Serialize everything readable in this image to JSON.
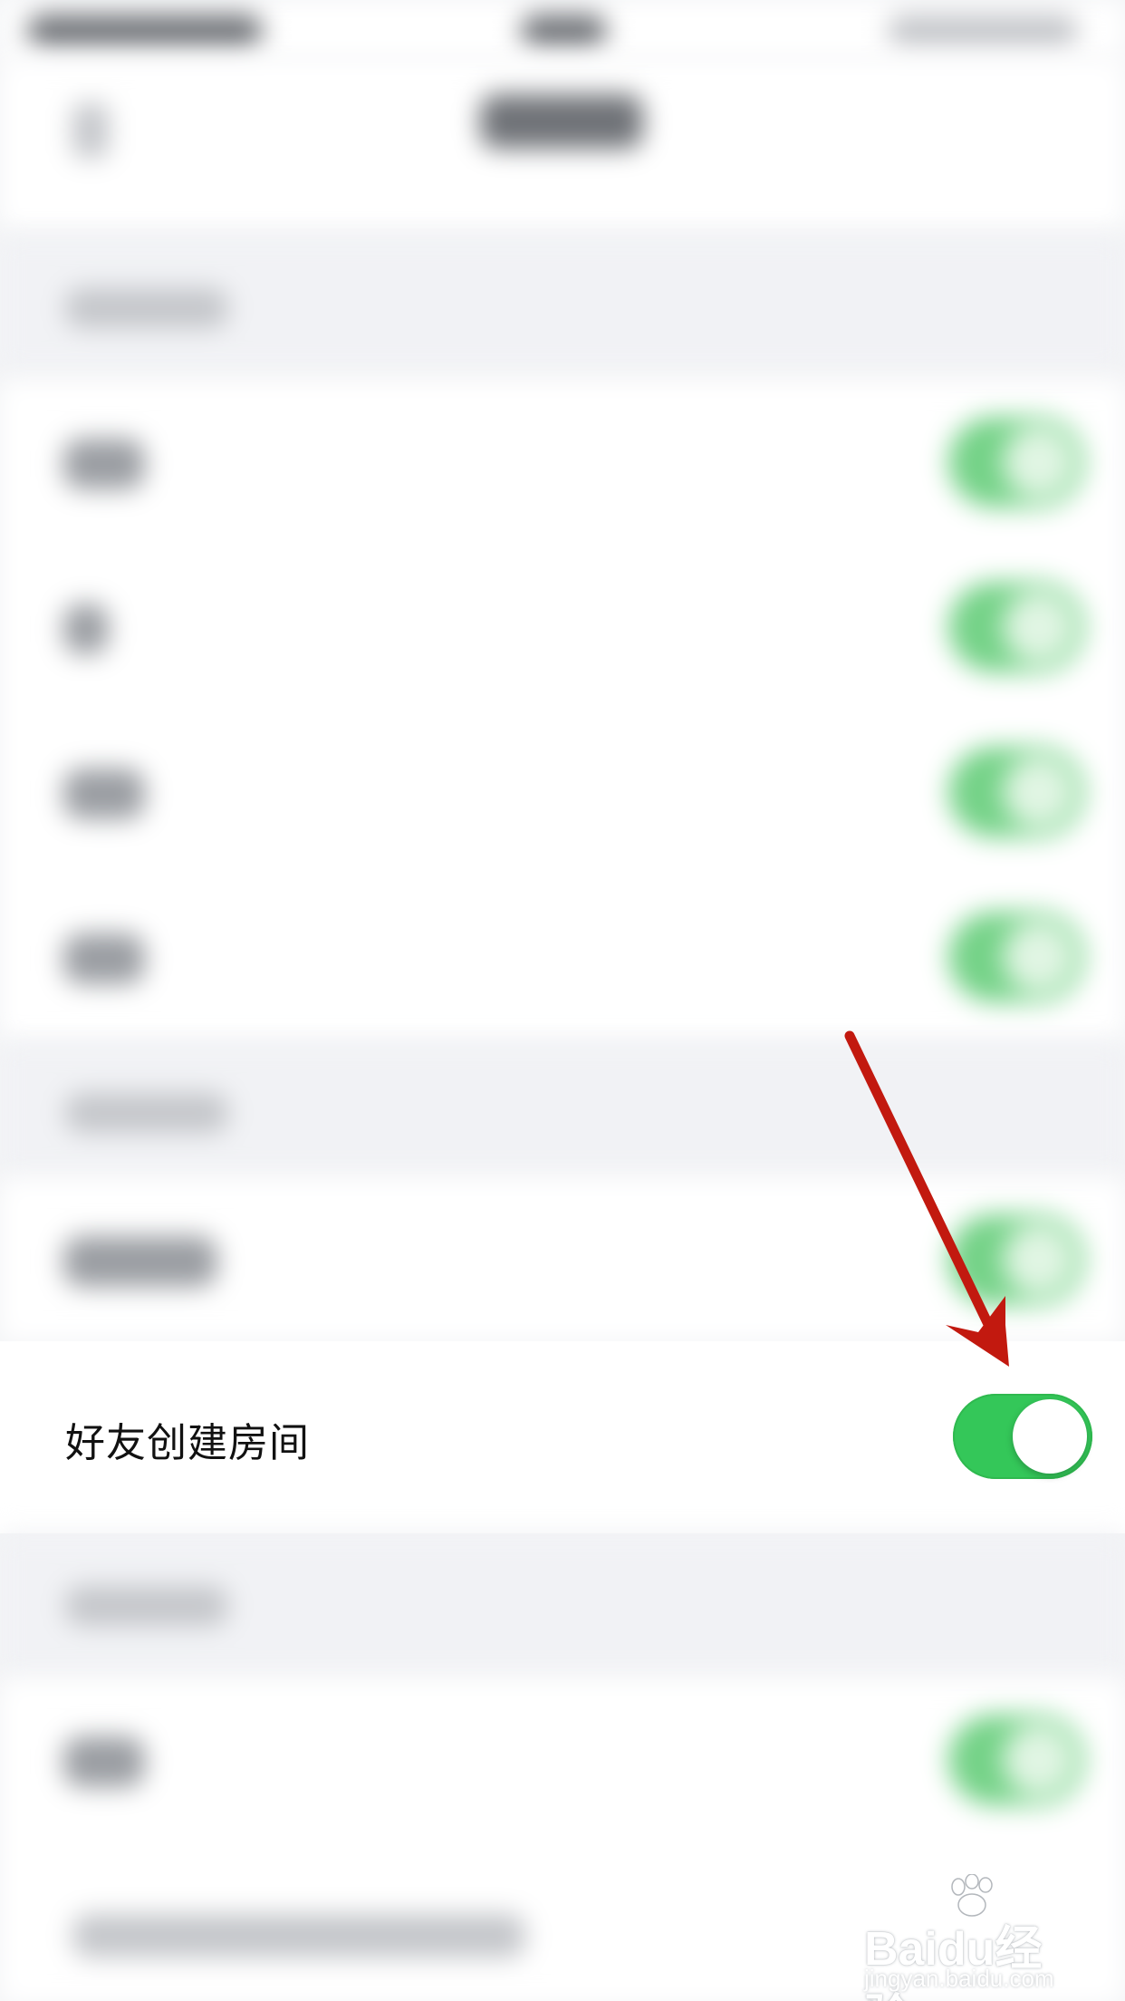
{
  "colors": {
    "toggle_on": "#34c759",
    "arrow": "#c2190f",
    "background": "#f3f4f6"
  },
  "focused_row": {
    "label": "好友创建房间",
    "toggle_state": "on"
  },
  "annotation": {
    "arrow_icon": "red-arrow-icon",
    "points_to": "toggle"
  },
  "watermark": {
    "brand": "Baidu经验",
    "url": "jingyan.baidu.com"
  }
}
